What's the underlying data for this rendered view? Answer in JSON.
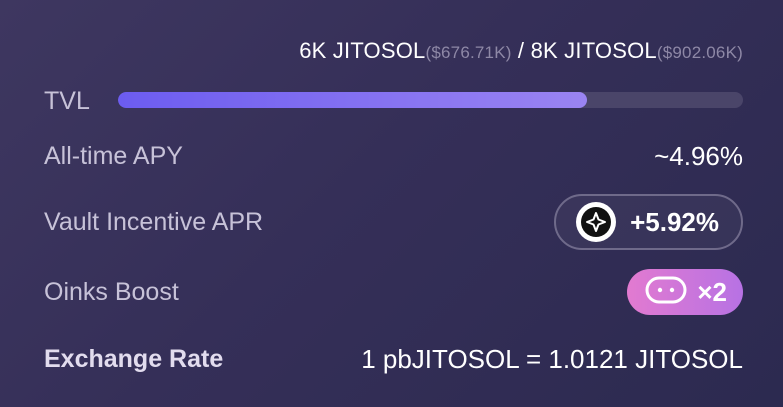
{
  "tvl": {
    "current_amount": "6K JITOSOL",
    "current_usd": "($676.71K)",
    "separator": " / ",
    "max_amount": "8K JITOSOL",
    "max_usd": "($902.06K)",
    "label": "TVL",
    "fill_fraction": 0.75
  },
  "apy": {
    "label": "All-time APY",
    "value": "~4.96%"
  },
  "incentive": {
    "label": "Vault Incentive APR",
    "value": "+5.92%",
    "icon": "token-icon"
  },
  "oinks": {
    "label": "Oinks Boost",
    "value": "×2",
    "icon": "pig-icon"
  },
  "exchange": {
    "label": "Exchange Rate",
    "value": "1 pbJITOSOL = 1.0121 JITOSOL"
  },
  "colors": {
    "progress_start": "#6c5cf0",
    "progress_end": "#9a84f2",
    "oinks_start": "#e27ad0",
    "oinks_end": "#b772e4"
  }
}
